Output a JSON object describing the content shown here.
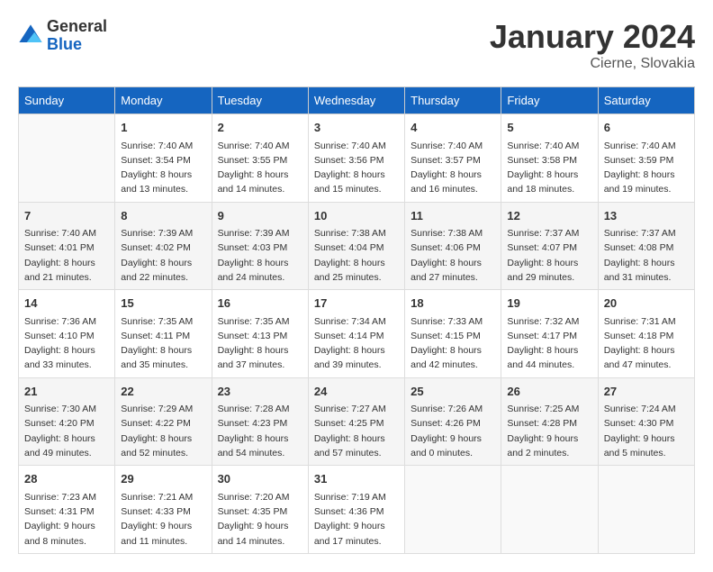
{
  "header": {
    "logo_general": "General",
    "logo_blue": "Blue",
    "month_title": "January 2024",
    "location": "Cierne, Slovakia"
  },
  "weekdays": [
    "Sunday",
    "Monday",
    "Tuesday",
    "Wednesday",
    "Thursday",
    "Friday",
    "Saturday"
  ],
  "weeks": [
    [
      {
        "day": "",
        "info": ""
      },
      {
        "day": "1",
        "info": "Sunrise: 7:40 AM\nSunset: 3:54 PM\nDaylight: 8 hours\nand 13 minutes."
      },
      {
        "day": "2",
        "info": "Sunrise: 7:40 AM\nSunset: 3:55 PM\nDaylight: 8 hours\nand 14 minutes."
      },
      {
        "day": "3",
        "info": "Sunrise: 7:40 AM\nSunset: 3:56 PM\nDaylight: 8 hours\nand 15 minutes."
      },
      {
        "day": "4",
        "info": "Sunrise: 7:40 AM\nSunset: 3:57 PM\nDaylight: 8 hours\nand 16 minutes."
      },
      {
        "day": "5",
        "info": "Sunrise: 7:40 AM\nSunset: 3:58 PM\nDaylight: 8 hours\nand 18 minutes."
      },
      {
        "day": "6",
        "info": "Sunrise: 7:40 AM\nSunset: 3:59 PM\nDaylight: 8 hours\nand 19 minutes."
      }
    ],
    [
      {
        "day": "7",
        "info": "Sunrise: 7:40 AM\nSunset: 4:01 PM\nDaylight: 8 hours\nand 21 minutes."
      },
      {
        "day": "8",
        "info": "Sunrise: 7:39 AM\nSunset: 4:02 PM\nDaylight: 8 hours\nand 22 minutes."
      },
      {
        "day": "9",
        "info": "Sunrise: 7:39 AM\nSunset: 4:03 PM\nDaylight: 8 hours\nand 24 minutes."
      },
      {
        "day": "10",
        "info": "Sunrise: 7:38 AM\nSunset: 4:04 PM\nDaylight: 8 hours\nand 25 minutes."
      },
      {
        "day": "11",
        "info": "Sunrise: 7:38 AM\nSunset: 4:06 PM\nDaylight: 8 hours\nand 27 minutes."
      },
      {
        "day": "12",
        "info": "Sunrise: 7:37 AM\nSunset: 4:07 PM\nDaylight: 8 hours\nand 29 minutes."
      },
      {
        "day": "13",
        "info": "Sunrise: 7:37 AM\nSunset: 4:08 PM\nDaylight: 8 hours\nand 31 minutes."
      }
    ],
    [
      {
        "day": "14",
        "info": "Sunrise: 7:36 AM\nSunset: 4:10 PM\nDaylight: 8 hours\nand 33 minutes."
      },
      {
        "day": "15",
        "info": "Sunrise: 7:35 AM\nSunset: 4:11 PM\nDaylight: 8 hours\nand 35 minutes."
      },
      {
        "day": "16",
        "info": "Sunrise: 7:35 AM\nSunset: 4:13 PM\nDaylight: 8 hours\nand 37 minutes."
      },
      {
        "day": "17",
        "info": "Sunrise: 7:34 AM\nSunset: 4:14 PM\nDaylight: 8 hours\nand 39 minutes."
      },
      {
        "day": "18",
        "info": "Sunrise: 7:33 AM\nSunset: 4:15 PM\nDaylight: 8 hours\nand 42 minutes."
      },
      {
        "day": "19",
        "info": "Sunrise: 7:32 AM\nSunset: 4:17 PM\nDaylight: 8 hours\nand 44 minutes."
      },
      {
        "day": "20",
        "info": "Sunrise: 7:31 AM\nSunset: 4:18 PM\nDaylight: 8 hours\nand 47 minutes."
      }
    ],
    [
      {
        "day": "21",
        "info": "Sunrise: 7:30 AM\nSunset: 4:20 PM\nDaylight: 8 hours\nand 49 minutes."
      },
      {
        "day": "22",
        "info": "Sunrise: 7:29 AM\nSunset: 4:22 PM\nDaylight: 8 hours\nand 52 minutes."
      },
      {
        "day": "23",
        "info": "Sunrise: 7:28 AM\nSunset: 4:23 PM\nDaylight: 8 hours\nand 54 minutes."
      },
      {
        "day": "24",
        "info": "Sunrise: 7:27 AM\nSunset: 4:25 PM\nDaylight: 8 hours\nand 57 minutes."
      },
      {
        "day": "25",
        "info": "Sunrise: 7:26 AM\nSunset: 4:26 PM\nDaylight: 9 hours\nand 0 minutes."
      },
      {
        "day": "26",
        "info": "Sunrise: 7:25 AM\nSunset: 4:28 PM\nDaylight: 9 hours\nand 2 minutes."
      },
      {
        "day": "27",
        "info": "Sunrise: 7:24 AM\nSunset: 4:30 PM\nDaylight: 9 hours\nand 5 minutes."
      }
    ],
    [
      {
        "day": "28",
        "info": "Sunrise: 7:23 AM\nSunset: 4:31 PM\nDaylight: 9 hours\nand 8 minutes."
      },
      {
        "day": "29",
        "info": "Sunrise: 7:21 AM\nSunset: 4:33 PM\nDaylight: 9 hours\nand 11 minutes."
      },
      {
        "day": "30",
        "info": "Sunrise: 7:20 AM\nSunset: 4:35 PM\nDaylight: 9 hours\nand 14 minutes."
      },
      {
        "day": "31",
        "info": "Sunrise: 7:19 AM\nSunset: 4:36 PM\nDaylight: 9 hours\nand 17 minutes."
      },
      {
        "day": "",
        "info": ""
      },
      {
        "day": "",
        "info": ""
      },
      {
        "day": "",
        "info": ""
      }
    ]
  ]
}
